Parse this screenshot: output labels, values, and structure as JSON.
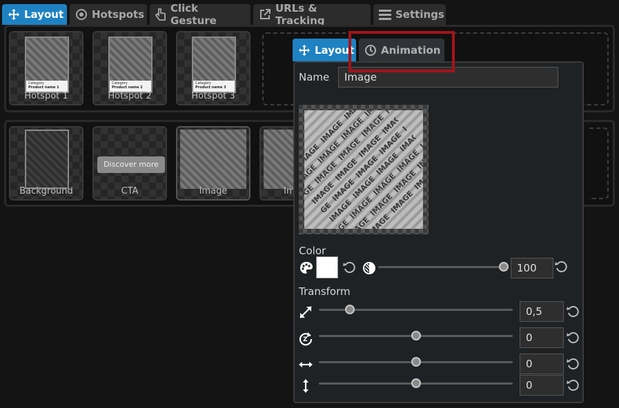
{
  "top_tabs": [
    {
      "label": "Layout",
      "icon": "move-icon"
    },
    {
      "label": "Hotspots",
      "icon": "target-icon"
    },
    {
      "label": "Click Gesture",
      "icon": "hand-pointer-icon"
    },
    {
      "label": "URLs & Tracking",
      "icon": "external-link-icon"
    },
    {
      "label": "Settings",
      "icon": "menu-icon"
    }
  ],
  "hotspots": [
    {
      "label": "Hotspot 1",
      "category": "Category",
      "product": "Product name 1"
    },
    {
      "label": "Hotspot 2",
      "category": "Category",
      "product": "Product name 2"
    },
    {
      "label": "Hotspot 3",
      "category": "Category",
      "product": "Product name 3"
    }
  ],
  "elements": [
    {
      "label": "Background"
    },
    {
      "label": "CTA",
      "button_text": "Discover more"
    },
    {
      "label": "Image"
    },
    {
      "label": "Im"
    }
  ],
  "popup": {
    "tabs": [
      {
        "label": "Layout",
        "icon": "move-icon"
      },
      {
        "label": "Animation",
        "icon": "clock-icon"
      }
    ],
    "name_label": "Name",
    "name_value": "Image",
    "preview_watermark": "IMAGE",
    "color_label": "Color",
    "swatch_color": "#ffffff",
    "opacity_value": "100",
    "opacity_fraction": 1.0,
    "transform_label": "Transform",
    "transform": [
      {
        "icon": "resize-icon",
        "value": "0,5",
        "fraction": 0.16
      },
      {
        "icon": "rotate-icon",
        "value": "0",
        "fraction": 0.5
      },
      {
        "icon": "horizontal-arrows-icon",
        "value": "0",
        "fraction": 0.5
      },
      {
        "icon": "vertical-arrows-icon",
        "value": "0",
        "fraction": 0.5
      }
    ]
  },
  "colors": {
    "accent": "#1e82c2",
    "highlight": "#a3141a"
  }
}
